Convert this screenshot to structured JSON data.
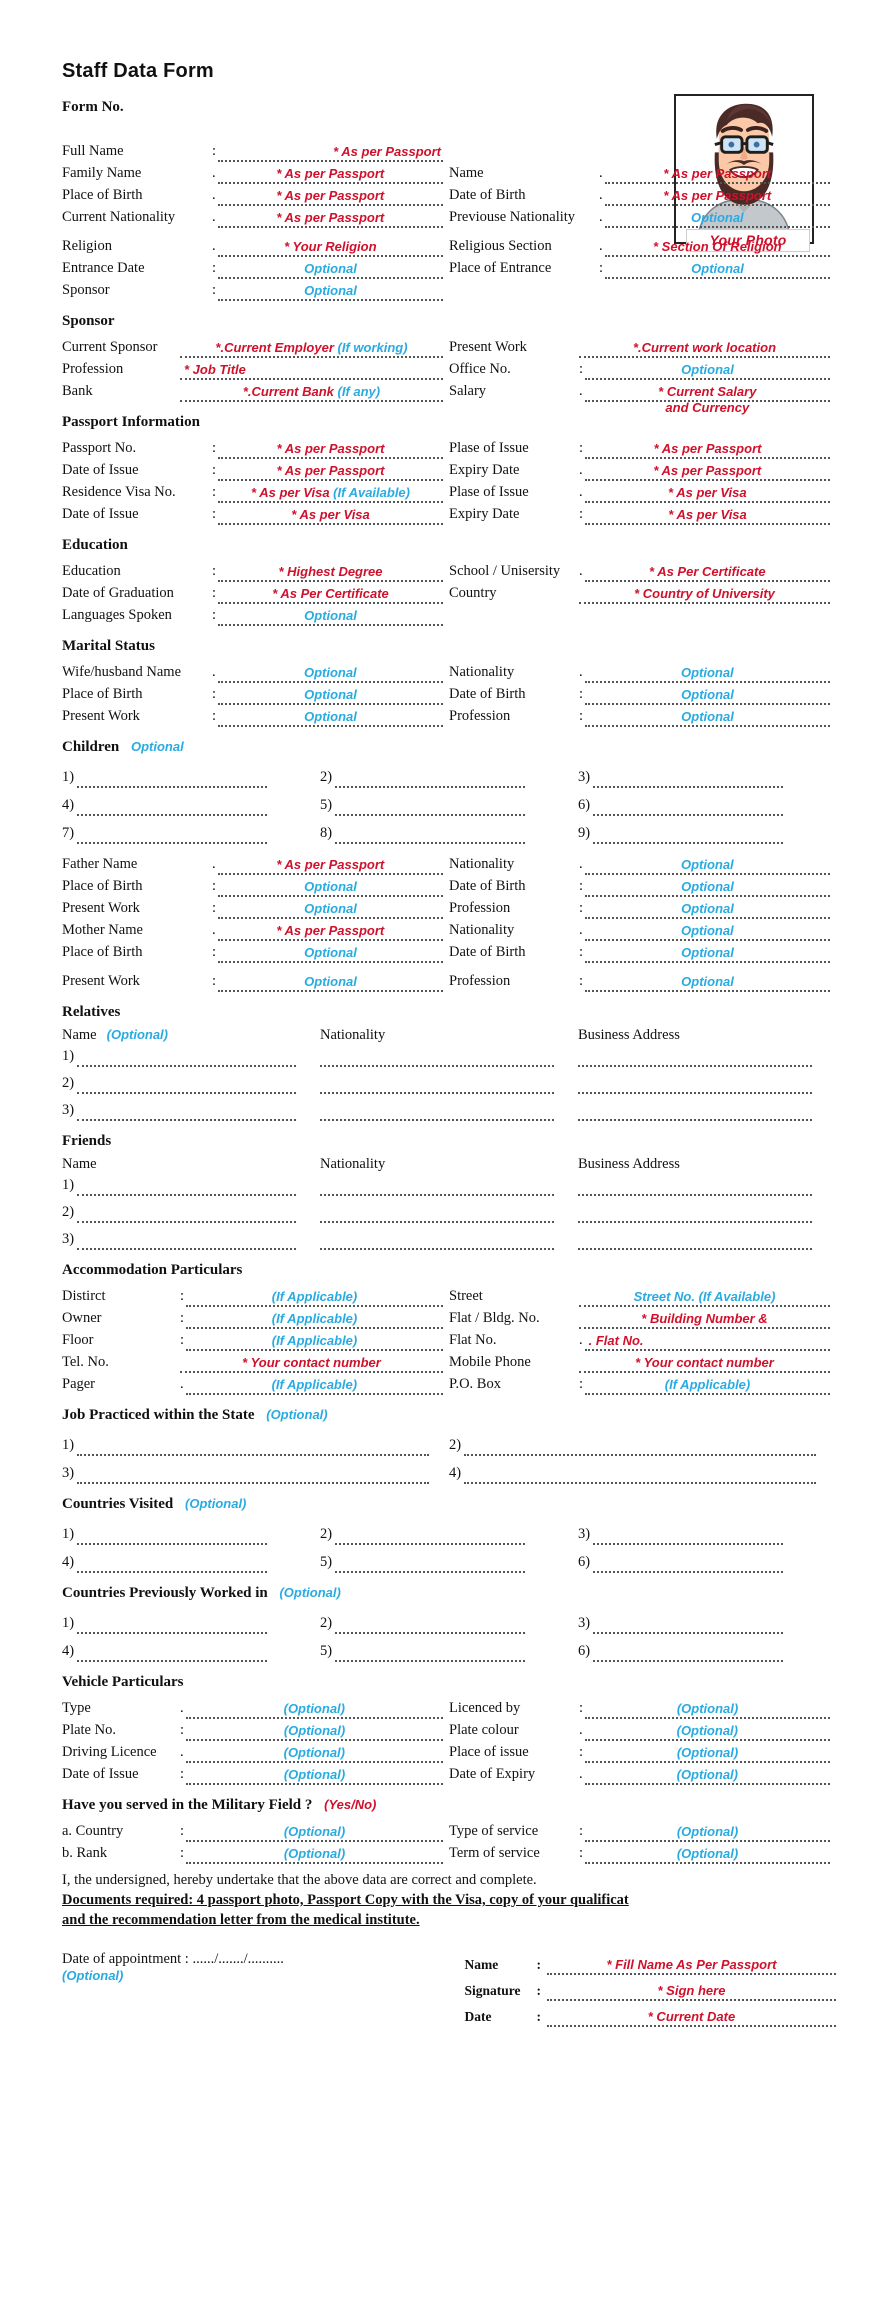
{
  "header": {
    "title": "Staff Data Form",
    "form_no_label": "Form No.",
    "photo_label": "Your Photo"
  },
  "colors": {
    "required_red": "#D0112B",
    "optional_cyan": "#29ABE2",
    "text_black": "#111111",
    "dotline_gray": "#555555"
  },
  "personal": {
    "full_name": {
      "label": "Full Name",
      "value": "* As per Passport"
    },
    "family_name": {
      "label": "Family Name",
      "value": "* As per Passport"
    },
    "place_of_birth": {
      "label": "Place of Birth",
      "value": "* As per Passport"
    },
    "current_nationality": {
      "label": "Current Nationality",
      "value": "* As per Passport"
    },
    "religion": {
      "label": "Religion",
      "value": "* Your Religion"
    },
    "entrance_date": {
      "label": "Entrance Date",
      "value": "Optional"
    },
    "sponsor": {
      "label": "Sponsor",
      "value": "Optional"
    },
    "name": {
      "label": "Name",
      "value": "* As per Passport"
    },
    "date_of_birth": {
      "label": "Date of Birth",
      "value": "* As per Passport"
    },
    "previous_nationality": {
      "label": "Previouse Nationality",
      "value": "Optional"
    },
    "religious_section": {
      "label": "Religious Section",
      "value": "* Section Of Religion"
    },
    "place_of_entrance": {
      "label": "Place of Entrance",
      "value": "Optional"
    }
  },
  "sponsor_section": {
    "title": "Sponsor",
    "current_sponsor": {
      "label": "Current Sponsor",
      "value_red": "*.Current Employer ",
      "value_cyan": "(If working)"
    },
    "profession": {
      "label": "Profession",
      "value": "* Job Title"
    },
    "bank": {
      "label": "Bank",
      "value_red": "*.Current Bank ",
      "value_cyan": "(If any)"
    },
    "present_work": {
      "label": "Present Work",
      "value": "*.Current work location"
    },
    "office_no": {
      "label": "Office No.",
      "value": "Optional"
    },
    "salary": {
      "label": "Salary",
      "value": "* Current Salary",
      "value_line2": "and Currency"
    }
  },
  "passport": {
    "title": "Passport Information",
    "passport_no": {
      "label": "Passport No.",
      "value": "* As per Passport"
    },
    "date_of_issue_1": {
      "label": "Date of Issue",
      "value": "* As per Passport"
    },
    "residence_visa_no": {
      "label": "Residence Visa No.",
      "value_red": "* As per Visa ",
      "value_cyan": "(If Available)"
    },
    "date_of_issue_2": {
      "label": "Date of Issue",
      "value": "* As per Visa"
    },
    "place_of_issue_1": {
      "label": "Plase of Issue",
      "value": "* As per Passport"
    },
    "expiry_date_1": {
      "label": "Expiry Date",
      "value": "* As per Passport"
    },
    "place_of_issue_2": {
      "label": "Plase of Issue",
      "value": "* As per Visa"
    },
    "expiry_date_2": {
      "label": "Expiry Date",
      "value": "* As per Visa"
    }
  },
  "education": {
    "title": "Education",
    "education": {
      "label": "Education",
      "value": "* Highest Degree"
    },
    "date_of_graduation": {
      "label": "Date of Graduation",
      "value": "* As Per Certificate"
    },
    "languages_spoken": {
      "label": "Languages Spoken",
      "value": "Optional"
    },
    "school_university": {
      "label": "School / Unisersity",
      "value": "* As Per Certificate"
    },
    "country": {
      "label": "Country",
      "value": "* Country of University"
    }
  },
  "marital": {
    "title": "Marital Status",
    "spouse_name": {
      "label": "Wife/husband Name",
      "value": "Optional"
    },
    "place_of_birth": {
      "label": "Place of Birth",
      "value": "Optional"
    },
    "present_work": {
      "label": "Present Work",
      "value": "Optional"
    },
    "nationality": {
      "label": "Nationality",
      "value": "Optional"
    },
    "date_of_birth": {
      "label": "Date of Birth",
      "value": "Optional"
    },
    "profession": {
      "label": "Profession",
      "value": "Optional"
    }
  },
  "children": {
    "title": "Children",
    "optional_tag": "Optional",
    "numbers": [
      "1)",
      "2)",
      "3)",
      "4)",
      "5)",
      "6)",
      "7)",
      "8)",
      "9)"
    ]
  },
  "parents": {
    "father_name": {
      "label": "Father Name",
      "value": "* As per Passport"
    },
    "father_place_of_birth": {
      "label": "Place of Birth",
      "value": "Optional"
    },
    "father_present_work": {
      "label": "Present Work",
      "value": "Optional"
    },
    "mother_name": {
      "label": "Mother Name",
      "value": "* As per Passport"
    },
    "mother_place_of_birth": {
      "label": "Place of Birth",
      "value": "Optional"
    },
    "mother_present_work": {
      "label": "Present Work",
      "value": "Optional"
    },
    "father_nationality": {
      "label": "Nationality",
      "value": "Optional"
    },
    "father_date_of_birth": {
      "label": "Date of Birth",
      "value": "Optional"
    },
    "father_profession": {
      "label": "Profession",
      "value": "Optional"
    },
    "mother_nationality": {
      "label": "Nationality",
      "value": "Optional"
    },
    "mother_date_of_birth": {
      "label": "Date of Birth",
      "value": "Optional"
    },
    "mother_profession": {
      "label": "Profession",
      "value": "Optional"
    }
  },
  "relatives": {
    "title": "Relatives",
    "col_name": "Name",
    "col_name_optional": "(Optional)",
    "col_nationality": "Nationality",
    "col_address": "Business Address",
    "numbers": [
      "1)",
      "2)",
      "3)"
    ]
  },
  "friends": {
    "title": "Friends",
    "col_name": "Name",
    "col_nationality": "Nationality",
    "col_address": "Business Address",
    "numbers": [
      "1)",
      "2)",
      "3)"
    ]
  },
  "accommodation": {
    "title": "Accommodation Particulars",
    "district": {
      "label": "Distirct",
      "value": "(If Applicable)"
    },
    "owner": {
      "label": "Owner",
      "value": "(If Applicable)"
    },
    "floor": {
      "label": "Floor",
      "value": "(If Applicable)"
    },
    "tel_no": {
      "label": "Tel. No.",
      "value": "* Your contact number"
    },
    "pager": {
      "label": "Pager",
      "value": "(If Applicable)"
    },
    "street": {
      "label": "Street",
      "value": "Street No. (If Available)"
    },
    "flat_bldg_no": {
      "label": "Flat / Bldg. No.",
      "value": "* Building Number &",
      "value_line2": ". Flat No."
    },
    "flat_no": {
      "label": "Flat No.",
      "value": ""
    },
    "mobile_phone": {
      "label": "Mobile Phone",
      "value": "* Your contact number"
    },
    "po_box": {
      "label": "P.O. Box",
      "value": "(If Applicable)"
    }
  },
  "job_in_state": {
    "title": "Job Practiced within the State",
    "optional_tag": "(Optional)",
    "numbers": [
      "1)",
      "2)",
      "3)",
      "4)"
    ]
  },
  "countries_visited": {
    "title": "Countries Visited",
    "optional_tag": "(Optional)",
    "numbers": [
      "1)",
      "2)",
      "3)",
      "4)",
      "5)",
      "6)"
    ]
  },
  "countries_worked": {
    "title": "Countries Previously Worked in",
    "optional_tag": "(Optional)",
    "numbers": [
      "1)",
      "2)",
      "3)",
      "4)",
      "5)",
      "6)"
    ]
  },
  "vehicle": {
    "title": "Vehicle Particulars",
    "type": {
      "label": "Type",
      "value": "(Optional)"
    },
    "plate_no": {
      "label": "Plate No.",
      "value": "(Optional)"
    },
    "driving_licence": {
      "label": "Driving Licence",
      "value": "(Optional)"
    },
    "date_of_issue": {
      "label": "Date of Issue",
      "value": "(Optional)"
    },
    "licenced_by": {
      "label": "Licenced by",
      "value": "(Optional)"
    },
    "plate_colour": {
      "label": "Plate colour",
      "value": "(Optional)"
    },
    "place_of_issue": {
      "label": "Place of issue",
      "value": "(Optional)"
    },
    "date_of_expiry": {
      "label": "Date of Expiry",
      "value": "(Optional)"
    }
  },
  "military": {
    "title": "Have you served in the Military Field ?",
    "yesno_tag": "(Yes/No)",
    "country": {
      "label": "a. Country",
      "value": "(Optional)"
    },
    "rank": {
      "label": "b. Rank",
      "value": "(Optional)"
    },
    "type_of_service": {
      "label": "Type of service",
      "value": "(Optional)"
    },
    "term_of_service": {
      "label": "Term of service",
      "value": "(Optional)"
    }
  },
  "declaration": {
    "undertaking": "I, the undersigned, hereby undertake that the above data are correct and complete.",
    "documents_line1": "Documents required: 4 passport photo, Passport Copy with the Visa, copy of your qualificat",
    "documents_line2": "and the recommendation letter from the medical institute.",
    "date_of_appointment": "Date of appointment : ....../......./..........",
    "date_of_appointment_optional": "(Optional)",
    "name_label": "Name",
    "name_value": "* Fill Name As Per Passport",
    "signature_label": "Signature",
    "signature_value": "* Sign here",
    "date_label": "Date",
    "date_value": "* Current Date",
    "colon": ":"
  }
}
